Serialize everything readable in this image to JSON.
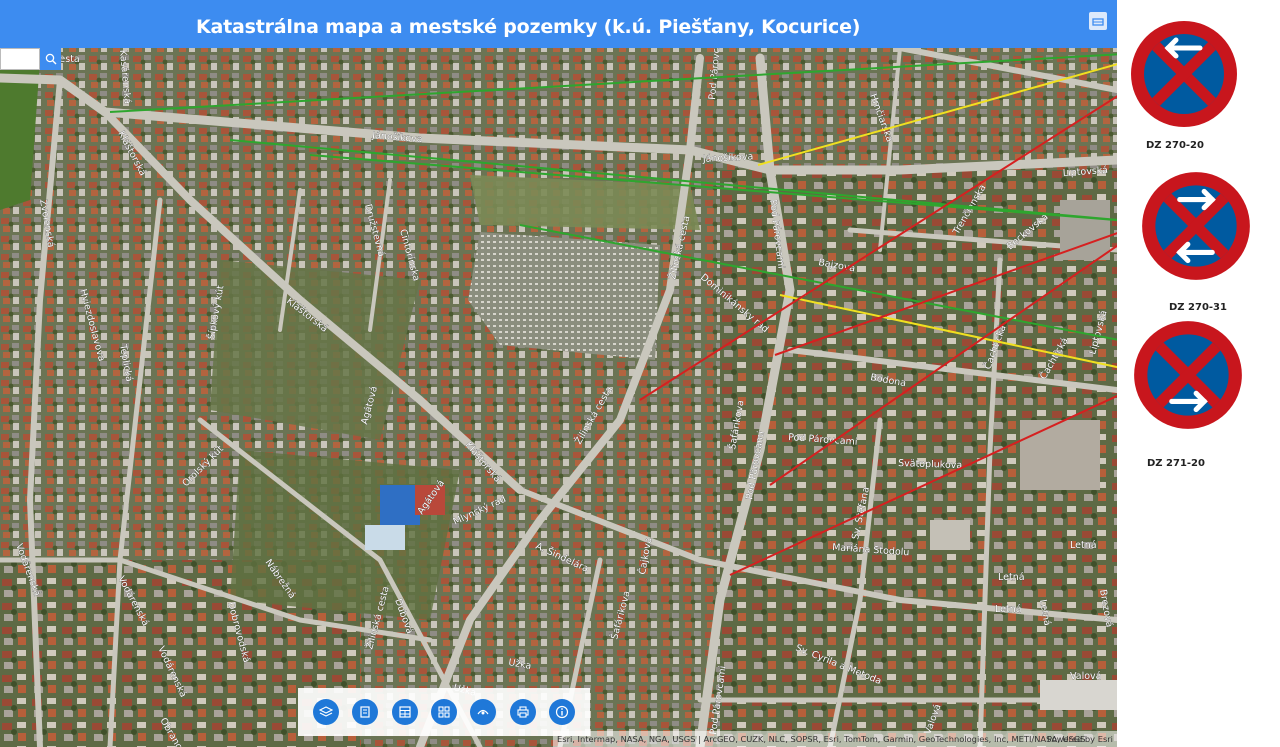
{
  "header": {
    "title": "Katastrálna mapa a mestské pozemky (k.ú. Piešťany, Kocurice)"
  },
  "search": {
    "placeholder": "",
    "value": ""
  },
  "map": {
    "streets": [
      {
        "name": "Jánošíkova"
      },
      {
        "name": "Jánošíkova"
      },
      {
        "name": "Kláštorská"
      },
      {
        "name": "Kláštorská"
      },
      {
        "name": "Kláštorská"
      },
      {
        "name": "Žilinská cesta"
      },
      {
        "name": "Žilinská cesta"
      },
      {
        "name": "Žilinská cesta"
      },
      {
        "name": "Dominikánsky rad"
      },
      {
        "name": "Pod Párovcami"
      },
      {
        "name": "Pod Párovcami"
      },
      {
        "name": "Pod Párovcami"
      },
      {
        "name": "Pod Párovcami"
      },
      {
        "name": "Pod Párovcami"
      },
      {
        "name": "Šafárikova"
      },
      {
        "name": "Šafárikova"
      },
      {
        "name": "Mlynský rad"
      },
      {
        "name": "A. Šindelára"
      },
      {
        "name": "Bodona"
      },
      {
        "name": "Svätoplukova"
      },
      {
        "name": "Sv. Cyrila a Metoda"
      },
      {
        "name": "Mariána Stodolu"
      },
      {
        "name": "Sv. Štefana"
      },
      {
        "name": "Letná"
      },
      {
        "name": "Letná"
      },
      {
        "name": "Letná"
      },
      {
        "name": "Valová"
      },
      {
        "name": "Valová"
      },
      {
        "name": "Agátová"
      },
      {
        "name": "Agátová"
      },
      {
        "name": "Orolský kút"
      },
      {
        "name": "Nábrežná"
      },
      {
        "name": "Vodárenská"
      },
      {
        "name": "Vodárenská"
      },
      {
        "name": "Dobrovodská"
      },
      {
        "name": "Čajkova"
      },
      {
        "name": "Šípkový kút"
      },
      {
        "name": "Beckovská"
      },
      {
        "name": "Trenčianska"
      },
      {
        "name": "Liptovská"
      },
      {
        "name": "Užka"
      },
      {
        "name": "Užka"
      },
      {
        "name": "Bajzova"
      },
      {
        "name": "Hrnčiarska"
      },
      {
        "name": "Čachtická"
      },
      {
        "name": "Hlohovská cesta"
      },
      {
        "name": "Zvolenská"
      },
      {
        "name": "Kasárenská"
      },
      {
        "name": "Hviezdoslavova"
      },
      {
        "name": "Teplická"
      },
      {
        "name": "Družstevná"
      },
      {
        "name": "Vodárenská"
      },
      {
        "name": "Obrancov"
      },
      {
        "name": "Dubová"
      },
      {
        "name": "Letná"
      },
      {
        "name": "Brezová"
      },
      {
        "name": "Cintorínska"
      },
      {
        "name": "Čachtická"
      },
      {
        "name": "Liptovská"
      }
    ],
    "lines": [
      {
        "color": "#2ea62e"
      },
      {
        "color": "#2ea62e"
      },
      {
        "color": "#2ea62e"
      },
      {
        "color": "#2ea62e"
      },
      {
        "color": "#f0e020"
      },
      {
        "color": "#f0e020"
      },
      {
        "color": "#d62020"
      },
      {
        "color": "#d62020"
      },
      {
        "color": "#d62020"
      },
      {
        "color": "#d62020"
      },
      {
        "color": "#f0e020"
      },
      {
        "color": "#f0e020"
      }
    ]
  },
  "attribution": {
    "text": "Esri, Intermap, NASA, NGA, USGS | ArcGEO, CUZK, NLC, SOPSR, Esri, TomTom, Garmin, GeoTechnologies, Inc, METI/NASA, USGS",
    "powered": "Powered by Esri"
  },
  "toolbar": {
    "buttons": [
      {
        "icon": "layers-icon"
      },
      {
        "icon": "legend-icon"
      },
      {
        "icon": "table-icon"
      },
      {
        "icon": "basemap-gallery-icon"
      },
      {
        "icon": "measure-icon"
      },
      {
        "icon": "print-icon"
      },
      {
        "icon": "info-icon"
      }
    ]
  },
  "legend": {
    "signs": [
      {
        "code": "DZ 270-20",
        "arrows": "left-top",
        "colors": {
          "ring": "#c8161d",
          "fill": "#005aa0"
        }
      },
      {
        "code": "DZ  270-31",
        "arrows": "both",
        "colors": {
          "ring": "#c8161d",
          "fill": "#005aa0"
        }
      },
      {
        "code": "DZ 271-20",
        "arrows": "right-bottom",
        "colors": {
          "ring": "#c8161d",
          "fill": "#005aa0"
        }
      }
    ]
  }
}
